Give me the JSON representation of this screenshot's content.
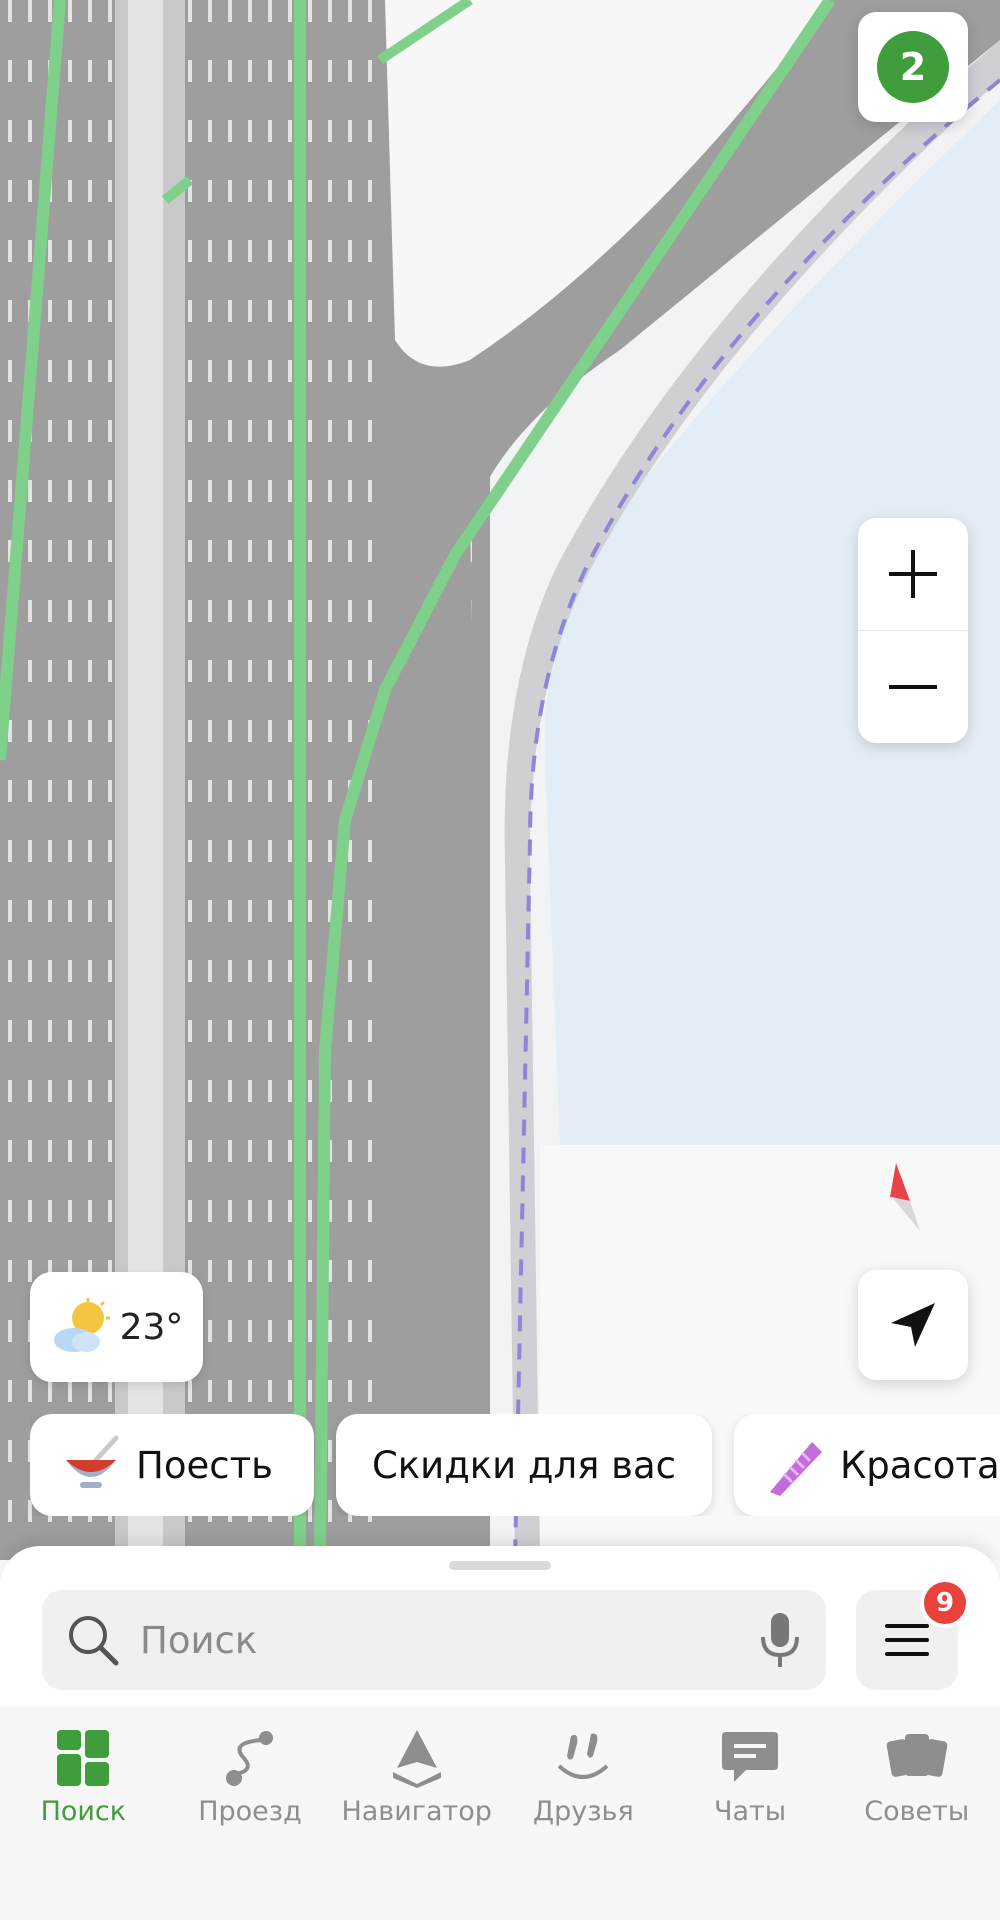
{
  "map": {
    "traffic_level": "2",
    "traffic_color": "#3f9d3c"
  },
  "weather": {
    "temperature": "23°",
    "icon": "sun-behind-cloud-icon"
  },
  "categories": [
    {
      "label": "Поесть",
      "icon": "bowl-icon"
    },
    {
      "label": "Скидки для вас",
      "icon": ""
    },
    {
      "label": "Красота",
      "icon": "comb-icon"
    }
  ],
  "search": {
    "placeholder": "Поиск",
    "value": ""
  },
  "menu": {
    "badge_count": "9",
    "badge_color": "#e8423c"
  },
  "tabs": [
    {
      "label": "Поиск",
      "icon": "grid-icon",
      "active": true
    },
    {
      "label": "Проезд",
      "icon": "route-icon",
      "active": false
    },
    {
      "label": "Навигатор",
      "icon": "navigator-icon",
      "active": false
    },
    {
      "label": "Друзья",
      "icon": "friends-icon",
      "active": false
    },
    {
      "label": "Чаты",
      "icon": "chat-icon",
      "active": false
    },
    {
      "label": "Советы",
      "icon": "tips-icon",
      "active": false
    }
  ],
  "accent_color": "#3f9d3c"
}
